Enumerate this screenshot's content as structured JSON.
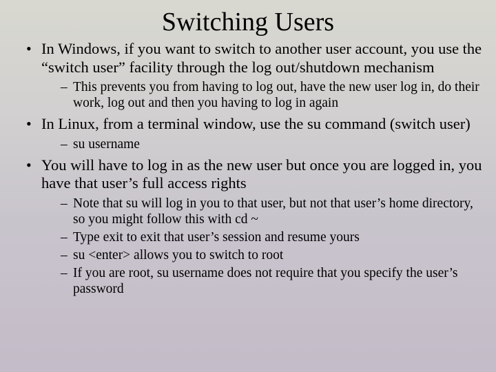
{
  "title": "Switching Users",
  "bullets": [
    {
      "text": "In Windows, if you want to switch to another user account, you use the “switch user” facility through the log out/shutdown mechanism",
      "sub": [
        "This prevents you from having to log out, have the new user log in, do their work, log out and then you having to log in again"
      ]
    },
    {
      "text": "In Linux, from a terminal window, use the su command (switch user)",
      "sub": [
        "su username"
      ]
    },
    {
      "text": "You will have to log in as the new user but once you are logged in, you have that user’s full access rights",
      "sub": [
        "Note that su will log in you to that user, but not that user’s home directory, so you might follow this with cd ~",
        "Type exit to exit that user’s session and resume yours",
        "su <enter> allows you to switch to root",
        "If you are root, su username does not require that you specify the user’s password"
      ]
    }
  ]
}
